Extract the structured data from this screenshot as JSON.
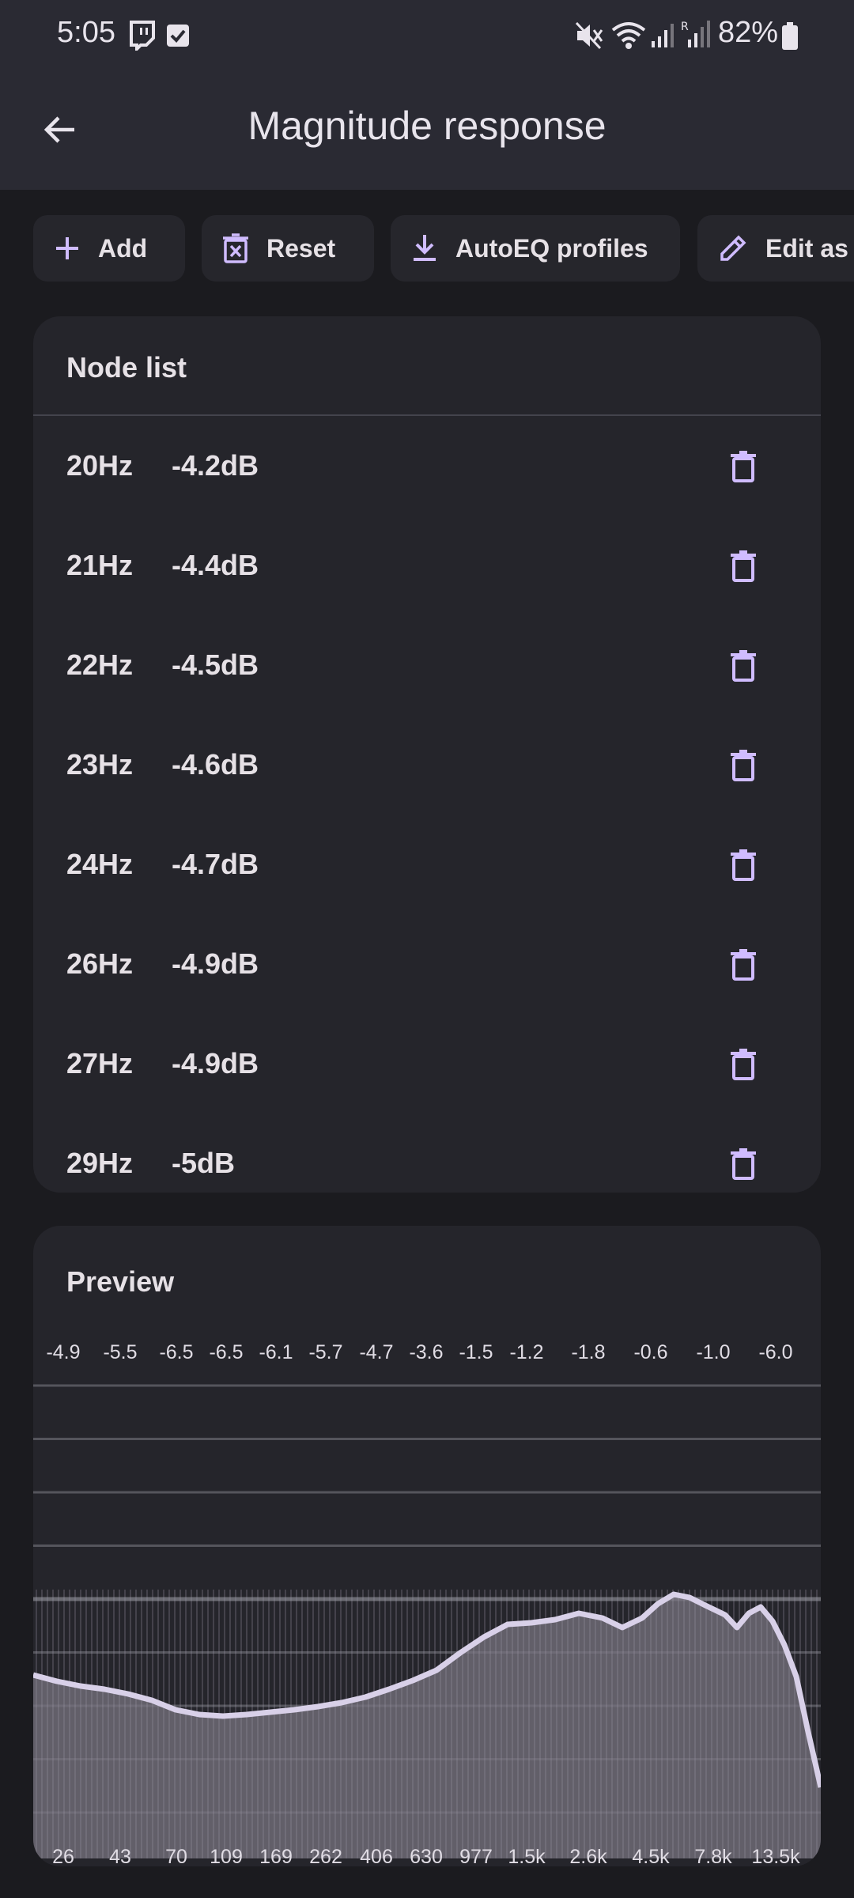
{
  "status": {
    "time": "5:05",
    "battery": "82%"
  },
  "appbar": {
    "title": "Magnitude response"
  },
  "toolbar": {
    "add_label": "Add",
    "reset_label": "Reset",
    "autoeq_label": "AutoEQ profiles",
    "edit_label": "Edit as"
  },
  "node_list": {
    "title": "Node list",
    "nodes": [
      {
        "freq": "20Hz",
        "gain": "-4.2dB"
      },
      {
        "freq": "21Hz",
        "gain": "-4.4dB"
      },
      {
        "freq": "22Hz",
        "gain": "-4.5dB"
      },
      {
        "freq": "23Hz",
        "gain": "-4.6dB"
      },
      {
        "freq": "24Hz",
        "gain": "-4.7dB"
      },
      {
        "freq": "26Hz",
        "gain": "-4.9dB"
      },
      {
        "freq": "27Hz",
        "gain": "-4.9dB"
      },
      {
        "freq": "29Hz",
        "gain": "-5dB"
      }
    ]
  },
  "preview": {
    "title": "Preview",
    "gain_labels": [
      "-4.9",
      "-5.5",
      "-6.5",
      "-6.5",
      "-6.1",
      "-5.7",
      "-4.7",
      "-3.6",
      "-1.5",
      "-1.2",
      "-1.8",
      "-0.6",
      "-1.0",
      "-6.0"
    ],
    "freq_labels": [
      "26",
      "43",
      "70",
      "109",
      "169",
      "262",
      "406",
      "630",
      "977",
      "1.5k",
      "2.6k",
      "4.5k",
      "7.8k",
      "13.5k"
    ]
  },
  "colors": {
    "accent": "#d0bcff",
    "surface": "#25252b",
    "background": "#1b1b1f",
    "curve": "#d8d0e8"
  }
}
